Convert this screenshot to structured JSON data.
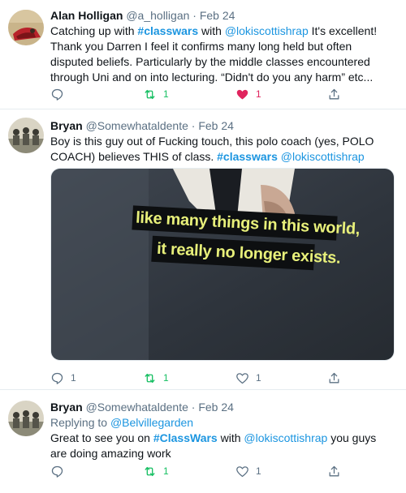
{
  "tweets": [
    {
      "name": "Alan Holligan",
      "handle": "@a_holligan",
      "dot": "·",
      "date": "Feb 24",
      "text": {
        "p1": "Catching up with ",
        "hashtag": "#classwars",
        "p2": " with ",
        "mention": "@lokiscottishrap",
        "p3": " It's excellent! Thank you Darren I feel it confirms many long held but often disputed beliefs. Particularly by the middle classes encountered through Uni and on into lecturing. “Didn't do you any harm” etc..."
      },
      "actions": {
        "reply": "",
        "retweet": "1",
        "like": "1"
      },
      "icons": [
        "reply-icon",
        "retweet-icon",
        "heart-filled-icon",
        "share-icon"
      ]
    },
    {
      "name": "Bryan",
      "handle": "@Somewhataldente",
      "dot": "·",
      "date": "Feb 24",
      "text": {
        "p1": "Boy is this guy out of Fucking touch,  this polo coach (yes, POLO COACH) believes THIS of class. ",
        "hashtag": "#classwars",
        "p2": " ",
        "mention": "@lokiscottishrap"
      },
      "media": {
        "caption1": "like many things in this world,",
        "caption2": "it really no longer exists."
      },
      "actions": {
        "reply": "1",
        "retweet": "1",
        "like": "1"
      },
      "icons": [
        "reply-icon",
        "retweet-icon",
        "heart-icon",
        "share-icon"
      ]
    },
    {
      "name": "Bryan",
      "handle": "@Somewhataldente",
      "dot": "·",
      "date": "Feb 24",
      "replying_prefix": "Replying to ",
      "replying_to": "@Belvillegarden",
      "text": {
        "p1": "Great to see you on ",
        "hashtag": "#ClassWars",
        "p2": " with ",
        "mention": "@lokiscottishrap",
        "p3": " you guys are doing amazing work"
      },
      "actions": {
        "reply": "",
        "retweet": "1",
        "like": "1"
      },
      "icons": [
        "reply-icon",
        "retweet-icon",
        "heart-icon",
        "share-icon"
      ]
    }
  ],
  "colors": {
    "link": "#1b95e0",
    "retweet": "#17bf63",
    "like": "#e0245e",
    "secondary": "#5b7083",
    "divider": "#e6ecf0"
  }
}
